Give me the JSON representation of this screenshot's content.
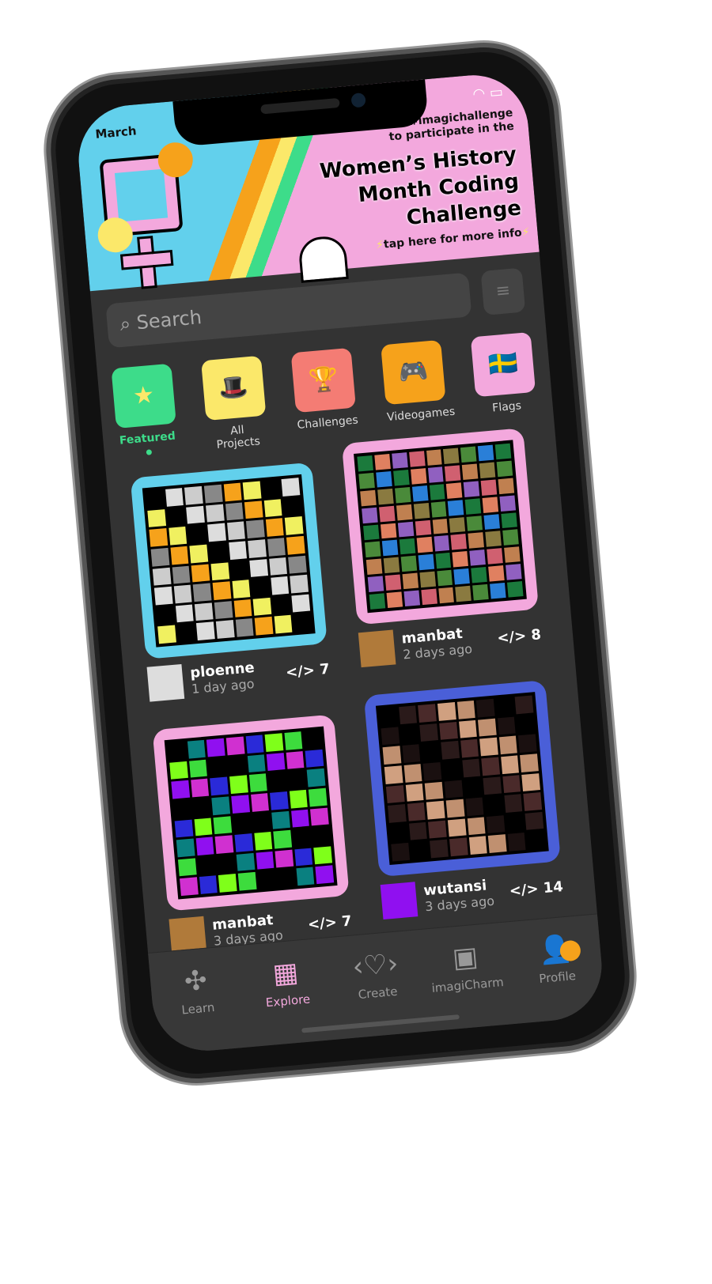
{
  "status": {
    "time": "March",
    "wifi": "wifi-icon",
    "battery": "battery-icon"
  },
  "banner": {
    "line1": "use #imagichallenge",
    "line2": "to participate in the",
    "title1": "Women’s History",
    "title2": "Month Coding",
    "title3": "Challenge",
    "tap": "tap here for more info"
  },
  "search": {
    "placeholder": "Search"
  },
  "categories": [
    {
      "label": "Featured",
      "icon": "★",
      "color": "#3ddc8a"
    },
    {
      "label": "All Projects",
      "icon": "🎩",
      "color": "#fbe86a"
    },
    {
      "label": "Challenges",
      "icon": "🏆",
      "color": "#f47c74"
    },
    {
      "label": "Videogames",
      "icon": "🎮",
      "color": "#f6a21b"
    },
    {
      "label": "Flags",
      "icon": "🇸🇪",
      "color": "#f3a8dd"
    }
  ],
  "projects": [
    {
      "user": "ploenne",
      "time": "1 day ago",
      "code_count": "7",
      "border": "#62d0ec"
    },
    {
      "user": "manbat",
      "time": "2 days ago",
      "code_count": "8",
      "border": "#f3a8dd"
    },
    {
      "user": "manbat",
      "time": "3 days ago",
      "code_count": "7",
      "border": "#f3a8dd"
    },
    {
      "user": "wutansi",
      "time": "3 days ago",
      "code_count": "14",
      "border": "#4a5fd8"
    }
  ],
  "code_symbol": "</>",
  "tabs": [
    {
      "label": "Learn",
      "icon": "puzzle-icon"
    },
    {
      "label": "Explore",
      "icon": "grid-icon"
    },
    {
      "label": "Create",
      "icon": "code-heart-icon"
    },
    {
      "label": "imagiCharm",
      "icon": "charm-icon"
    },
    {
      "label": "Profile",
      "icon": "person-icon"
    }
  ],
  "colors": {
    "accent_explore": "#f3a8dd",
    "accent_featured": "#3ddc8a",
    "badge": "#f6a21b"
  }
}
